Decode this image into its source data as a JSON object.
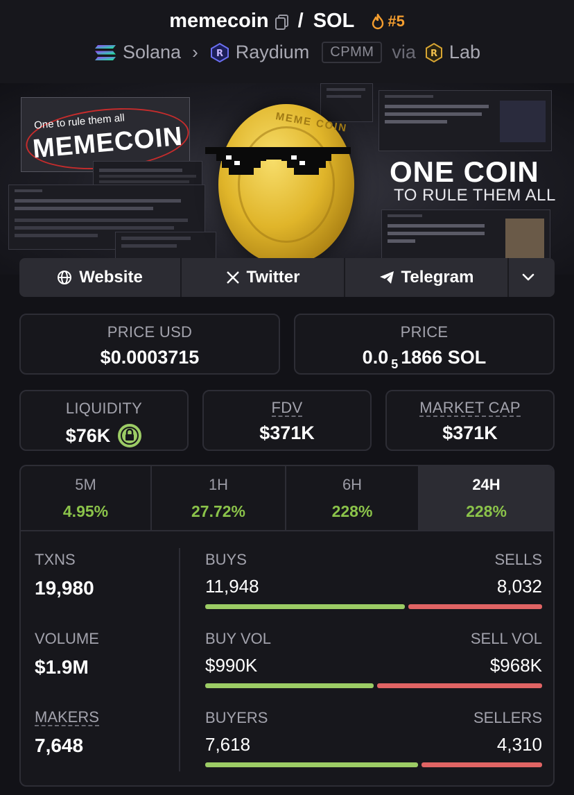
{
  "header": {
    "token_name": "memecoin",
    "quote": "SOL",
    "rank": "#5",
    "chain": "Solana",
    "dex": "Raydium",
    "pool_type": "CPMM",
    "via_label": "via",
    "launchpad": "Lab",
    "colors": {
      "rank": "#f59e2f",
      "background": "#17171c"
    }
  },
  "banner": {
    "left_tagline": "One to rule them all",
    "left_title": "MEMECOIN",
    "headline": "ONE COIN",
    "subheadline": "TO RULE THEM ALL",
    "coin_text": "MEME COIN"
  },
  "links": {
    "website": "Website",
    "twitter": "Twitter",
    "telegram": "Telegram",
    "icons": [
      "globe-icon",
      "x-icon",
      "telegram-icon",
      "chevron-down-icon"
    ]
  },
  "prices": {
    "price_usd_label": "PRICE USD",
    "price_usd": "$0.0003715",
    "price_label": "PRICE",
    "price_prefix": "0.0",
    "price_zeros": "5",
    "price_suffix": "1866 SOL"
  },
  "metrics": {
    "liquidity_label": "LIQUIDITY",
    "liquidity": "$76K",
    "fdv_label": "FDV",
    "fdv": "$371K",
    "mcap_label": "MARKET CAP",
    "mcap": "$371K"
  },
  "timeframes": [
    {
      "label": "5M",
      "change": "4.95%"
    },
    {
      "label": "1H",
      "change": "27.72%"
    },
    {
      "label": "6H",
      "change": "228%"
    },
    {
      "label": "24H",
      "change": "228%",
      "active": true
    }
  ],
  "stats": {
    "txns_label": "TXNS",
    "txns": "19,980",
    "volume_label": "VOLUME",
    "volume": "$1.9M",
    "makers_label": "MAKERS",
    "makers": "7,648",
    "buys_label": "BUYS",
    "buys": "11,948",
    "sells_label": "SELLS",
    "sells": "8,032",
    "buy_vol_label": "BUY VOL",
    "buy_vol": "$990K",
    "sell_vol_label": "SELL VOL",
    "sell_vol": "$968K",
    "buyers_label": "BUYERS",
    "buyers": "7,618",
    "sellers_label": "SELLERS",
    "sellers": "4,310",
    "buy_share_txns": 0.598,
    "buy_share_vol": 0.506,
    "buy_share_makers": 0.639,
    "colors": {
      "positive": "#8bc34a",
      "buy_bar": "#9ccc65",
      "sell_bar": "#e06464"
    }
  }
}
